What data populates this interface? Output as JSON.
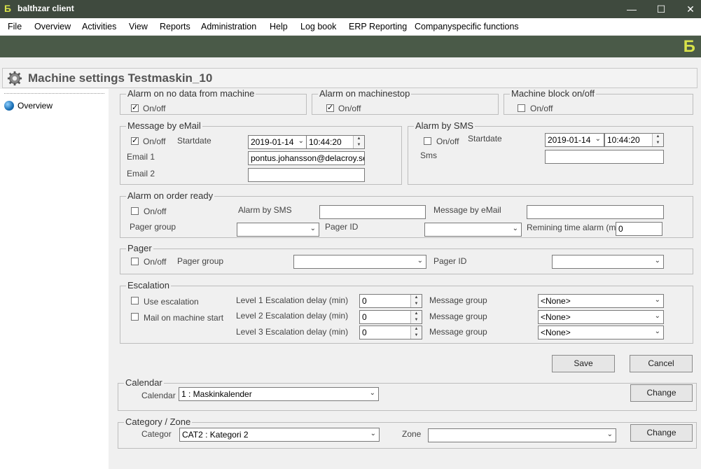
{
  "window": {
    "title": "balthzar client",
    "controls": {
      "minimize": "—",
      "maximize": "☐",
      "close": "✕"
    }
  },
  "menu": [
    "File",
    "Overview",
    "Activities",
    "View",
    "Reports",
    "Administration",
    "Help",
    "Log book",
    "ERP Reporting",
    "Companyspecific functions"
  ],
  "header": {
    "title": "Machine settings Testmaskin_10"
  },
  "nav": {
    "overview": "Overview"
  },
  "groups": {
    "nodata": {
      "title": "Alarm on no data from machine",
      "onoff": "On/off",
      "checked": true
    },
    "machinestop": {
      "title": "Alarm on machinestop",
      "onoff": "On/off",
      "checked": true
    },
    "machineblock": {
      "title": "Machine block on/off",
      "onoff": "On/off",
      "checked": false
    },
    "email": {
      "title": "Message by eMail",
      "onoff": "On/off",
      "checked": true,
      "startdate_label": "Startdate",
      "date": "2019-01-14",
      "time": "10:44:20",
      "email1_label": "Email 1",
      "email1": "pontus.johansson@delacroy.se",
      "email2_label": "Email 2",
      "email2": ""
    },
    "sms": {
      "title": "Alarm by SMS",
      "onoff": "On/off",
      "checked": false,
      "startdate_label": "Startdate",
      "date": "2019-01-14",
      "time": "10:44:20",
      "sms_label": "Sms",
      "sms": ""
    },
    "orderready": {
      "title": "Alarm on order ready",
      "onoff": "On/off",
      "checked": false,
      "alarm_sms_label": "Alarm by SMS",
      "alarm_sms": "",
      "msg_email_label": "Message by eMail",
      "msg_email": "",
      "pager_group_label": "Pager group",
      "pager_group": "",
      "pager_id_label": "Pager ID",
      "pager_id": "",
      "remaining_label": "Remining time alarm (min",
      "remaining": "0"
    },
    "pager": {
      "title": "Pager",
      "onoff": "On/off",
      "checked": false,
      "pager_group_label": "Pager group",
      "pager_group": "",
      "pager_id_label": "Pager ID",
      "pager_id": ""
    },
    "escalation": {
      "title": "Escalation",
      "use_label": "Use escalation",
      "use_checked": false,
      "mail_label": "Mail on machine start",
      "mail_checked": false,
      "levels": [
        {
          "label": "Level 1 Escalation delay (min)",
          "value": "0",
          "group_label": "Message group",
          "group": "<None>"
        },
        {
          "label": "Level 2 Escalation delay (min)",
          "value": "0",
          "group_label": "Message group",
          "group": "<None>"
        },
        {
          "label": "Level 3 Escalation delay (min)",
          "value": "0",
          "group_label": "Message group",
          "group": "<None>"
        }
      ]
    },
    "calendar": {
      "title": "Calendar",
      "label": "Calendar",
      "value": "1 : Maskinkalender",
      "change": "Change"
    },
    "category": {
      "title": "Category / Zone",
      "label": "Categor",
      "value": "CAT2 : Kategori 2",
      "zone_label": "Zone",
      "zone": "",
      "change": "Change"
    }
  },
  "buttons": {
    "save": "Save",
    "cancel": "Cancel"
  },
  "icons": {
    "app": "Ƃ",
    "brand": "Ƃ",
    "dropdown": "⌄",
    "spin_up": "▲",
    "spin_down": "▼"
  }
}
